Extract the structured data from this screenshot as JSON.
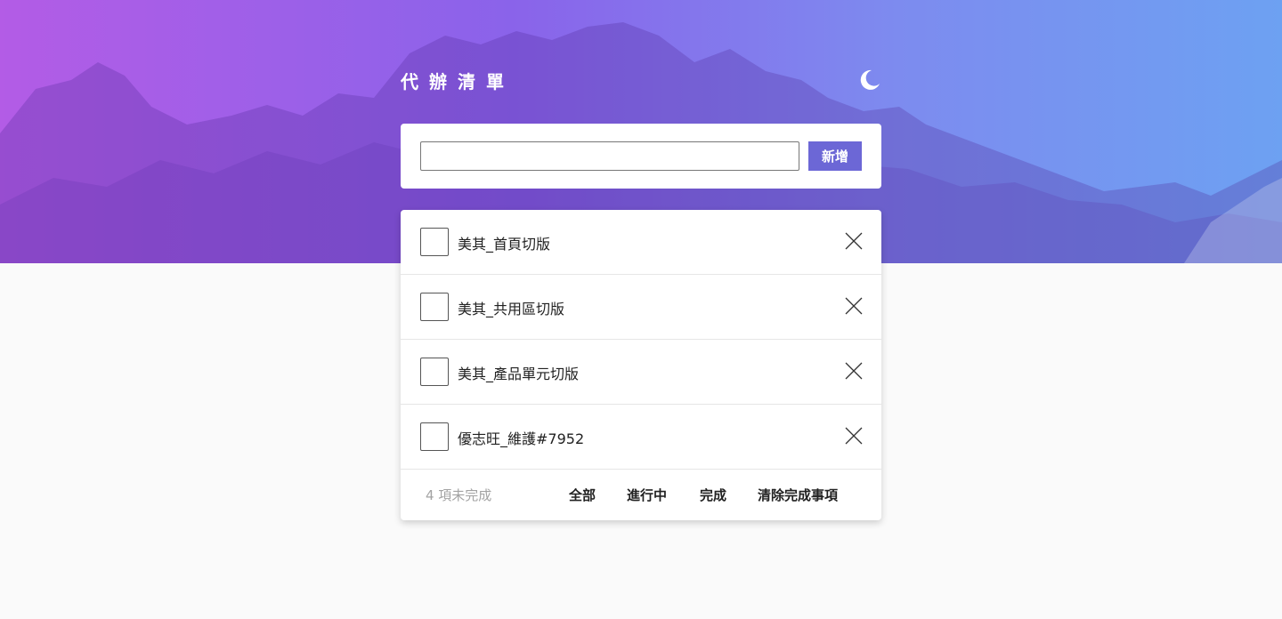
{
  "header": {
    "title": "代辦清單",
    "theme_toggle_icon": "moon-icon"
  },
  "input_card": {
    "input_value": "",
    "input_placeholder": "",
    "add_label": "新增",
    "add_color": "#6c67d6"
  },
  "todos": [
    {
      "text": "美其_首頁切版",
      "done": false
    },
    {
      "text": "美其_共用區切版",
      "done": false
    },
    {
      "text": "美其_產品單元切版",
      "done": false
    },
    {
      "text": "優志旺_維護#7952",
      "done": false
    }
  ],
  "footer": {
    "remaining": "4 項未完成",
    "filter_all": "全部",
    "filter_active": "進行中",
    "filter_done": "完成",
    "clear_done": "清除完成事項"
  },
  "colors": {
    "hero_gradient_start": "#b35ce6",
    "hero_gradient_end": "#6da1f2",
    "page_background": "#fafafa"
  }
}
